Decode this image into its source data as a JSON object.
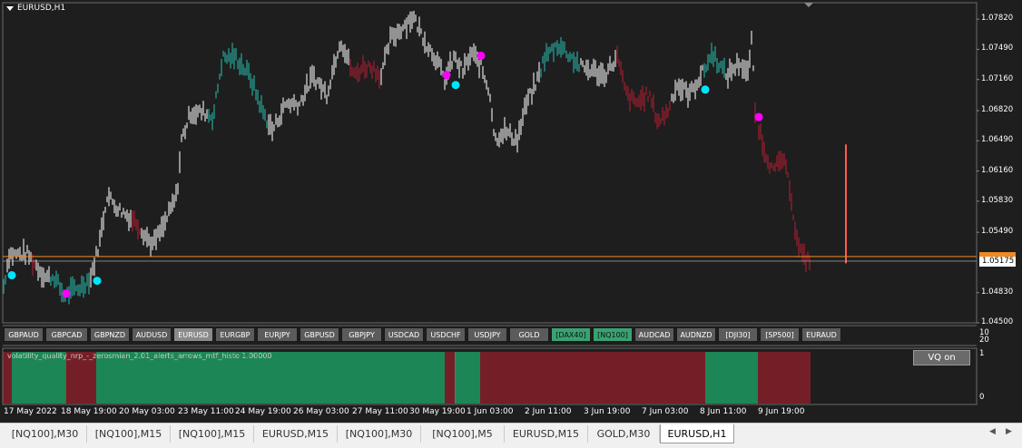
{
  "window": {
    "title": "EURUSD,H1"
  },
  "price_axis": [
    "1.07820",
    "1.07490",
    "1.07160",
    "1.06820",
    "1.06490",
    "1.06160",
    "1.05830",
    "1.05490",
    "1.04830",
    "1.04500"
  ],
  "current_price": "1.05175",
  "time_axis": [
    "17 May 2022",
    "18 May 19:00",
    "20 May 03:00",
    "23 May 11:00",
    "24 May 19:00",
    "26 May 03:00",
    "27 May 11:00",
    "30 May 19:00",
    "1 Jun 03:00",
    "2 Jun 11:00",
    "3 Jun 19:00",
    "7 Jun 03:00",
    "8 Jun 11:00",
    "9 Jun 19:00"
  ],
  "tickers": [
    {
      "label": "GBPAUD",
      "state": "normal"
    },
    {
      "label": "GBPCAD",
      "state": "normal"
    },
    {
      "label": "GBPNZD",
      "state": "normal"
    },
    {
      "label": "AUDUSD",
      "state": "normal"
    },
    {
      "label": "EURUSD",
      "state": "active"
    },
    {
      "label": "EURGBP",
      "state": "normal"
    },
    {
      "label": "EURJPY",
      "state": "normal"
    },
    {
      "label": "GBPUSD",
      "state": "normal"
    },
    {
      "label": "GBPJPY",
      "state": "normal"
    },
    {
      "label": "USDCAD",
      "state": "normal"
    },
    {
      "label": "USDCHF",
      "state": "normal"
    },
    {
      "label": "USDJPY",
      "state": "normal"
    },
    {
      "label": "GOLD",
      "state": "normal"
    },
    {
      "label": "[DAX40]",
      "state": "green"
    },
    {
      "label": "[NQ100]",
      "state": "green"
    },
    {
      "label": "AUDCAD",
      "state": "normal"
    },
    {
      "label": "AUDNZD",
      "state": "normal"
    },
    {
      "label": "[DJI30]",
      "state": "normal"
    },
    {
      "label": "[SP500]",
      "state": "normal"
    },
    {
      "label": "EURAUD",
      "state": "normal"
    }
  ],
  "indicator": {
    "label": "volatility_quality_nrp_-_zerosmian_2.01_alerts_arrows_mtf_histo 1.00000",
    "button": "VQ on",
    "scale_top": "20",
    "scale_1": "1",
    "scale_0": "0",
    "scale_sep": "10"
  },
  "tabs": [
    "[NQ100],M30",
    "[NQ100],M15",
    "[NQ100],M15",
    "EURUSD,M15",
    "[NQ100],M30",
    "[NQ100],M5",
    "EURUSD,M15",
    "GOLD,M30",
    "EURUSD,H1"
  ],
  "active_tab_index": 8,
  "colors": {
    "bull": "#26a69a",
    "bull_bright": "#2ecc8a",
    "bear": "#a01f2e",
    "neutral": "#e0e0e0",
    "signal_up": "#00e5ff",
    "signal_down": "#ff00ff",
    "price_line": "#f08a24",
    "histo_green": "#1dbf74",
    "histo_red": "#a3202d"
  },
  "chart_data": {
    "type": "bar",
    "title": "EURUSD,H1",
    "ylim": [
      1.045,
      1.0795
    ],
    "series_color_segments": [
      {
        "color": "bull",
        "from": 0,
        "to": 8
      },
      {
        "color": "neutral",
        "from": 8,
        "to": 36
      },
      {
        "color": "bear",
        "from": 36,
        "to": 40
      },
      {
        "color": "neutral",
        "from": 40,
        "to": 56
      },
      {
        "color": "bull",
        "from": 56,
        "to": 100
      },
      {
        "color": "neutral",
        "from": 100,
        "to": 145
      },
      {
        "color": "bear",
        "from": 145,
        "to": 155
      },
      {
        "color": "neutral",
        "from": 155,
        "to": 230
      },
      {
        "color": "bull",
        "from": 230,
        "to": 295
      },
      {
        "color": "neutral",
        "from": 295,
        "to": 385
      },
      {
        "color": "bear",
        "from": 385,
        "to": 420
      },
      {
        "color": "neutral",
        "from": 420,
        "to": 595
      },
      {
        "color": "bull",
        "from": 595,
        "to": 640
      },
      {
        "color": "neutral",
        "from": 640,
        "to": 680
      },
      {
        "color": "bear",
        "from": 680,
        "to": 740
      },
      {
        "color": "neutral",
        "from": 740,
        "to": 775
      },
      {
        "color": "bull",
        "from": 775,
        "to": 800
      },
      {
        "color": "neutral",
        "from": 800,
        "to": 832
      },
      {
        "color": "bear",
        "from": 832,
        "to": 895
      }
    ],
    "price_path": [
      [
        4,
        1.049
      ],
      [
        10,
        1.0525
      ],
      [
        30,
        1.0525
      ],
      [
        42,
        1.051
      ],
      [
        50,
        1.05
      ],
      [
        60,
        1.05
      ],
      [
        70,
        1.048
      ],
      [
        80,
        1.0485
      ],
      [
        90,
        1.049
      ],
      [
        100,
        1.05
      ],
      [
        110,
        1.054
      ],
      [
        118,
        1.059
      ],
      [
        130,
        1.0575
      ],
      [
        150,
        1.056
      ],
      [
        168,
        1.0535
      ],
      [
        180,
        1.0555
      ],
      [
        195,
        1.059
      ],
      [
        200,
        1.065
      ],
      [
        210,
        1.068
      ],
      [
        225,
        1.068
      ],
      [
        235,
        1.0675
      ],
      [
        245,
        1.074
      ],
      [
        260,
        1.074
      ],
      [
        275,
        1.072
      ],
      [
        290,
        1.068
      ],
      [
        300,
        1.066
      ],
      [
        315,
        1.069
      ],
      [
        330,
        1.069
      ],
      [
        345,
        1.072
      ],
      [
        360,
        1.07
      ],
      [
        375,
        1.076
      ],
      [
        390,
        1.072
      ],
      [
        400,
        1.073
      ],
      [
        410,
        1.073
      ],
      [
        420,
        1.072
      ],
      [
        430,
        1.076
      ],
      [
        440,
        1.077
      ],
      [
        455,
        1.0785
      ],
      [
        465,
        1.0765
      ],
      [
        470,
        1.0755
      ],
      [
        480,
        1.074
      ],
      [
        490,
        1.0715
      ],
      [
        500,
        1.074
      ],
      [
        510,
        1.0725
      ],
      [
        520,
        1.0745
      ],
      [
        530,
        1.073
      ],
      [
        540,
        1.07
      ],
      [
        545,
        1.065
      ],
      [
        555,
        1.066
      ],
      [
        570,
        1.065
      ],
      [
        580,
        1.069
      ],
      [
        590,
        1.071
      ],
      [
        600,
        1.074
      ],
      [
        615,
        1.0755
      ],
      [
        625,
        1.0745
      ],
      [
        640,
        1.073
      ],
      [
        655,
        1.0725
      ],
      [
        665,
        1.072
      ],
      [
        680,
        1.074
      ],
      [
        690,
        1.07
      ],
      [
        700,
        1.069
      ],
      [
        715,
        1.07
      ],
      [
        725,
        1.067
      ],
      [
        735,
        1.068
      ],
      [
        745,
        1.071
      ],
      [
        760,
        1.07
      ],
      [
        775,
        1.0725
      ],
      [
        785,
        1.0745
      ],
      [
        800,
        1.072
      ],
      [
        815,
        1.0735
      ],
      [
        825,
        1.072
      ],
      [
        828,
        1.0765
      ],
      [
        832,
        1.068
      ],
      [
        842,
        1.064
      ],
      [
        852,
        1.0615
      ],
      [
        862,
        1.063
      ],
      [
        870,
        1.06
      ],
      [
        878,
        1.054
      ],
      [
        885,
        1.052
      ],
      [
        892,
        1.052
      ]
    ],
    "signals": [
      {
        "type": "up",
        "x": 13,
        "price": 1.0502
      },
      {
        "type": "down",
        "x": 73,
        "price": 1.0482
      },
      {
        "type": "up",
        "x": 107,
        "price": 1.0496
      },
      {
        "type": "down",
        "x": 492,
        "price": 1.0721
      },
      {
        "type": "up",
        "x": 502,
        "price": 1.071
      },
      {
        "type": "down",
        "x": 530,
        "price": 1.0742
      },
      {
        "type": "up",
        "x": 777,
        "price": 1.0705
      },
      {
        "type": "down",
        "x": 836,
        "price": 1.0675
      }
    ],
    "spike": {
      "x": 932,
      "from": 1.0515,
      "to": 1.0645
    },
    "histogram_segments": [
      {
        "color": "histo_red",
        "from": 4,
        "to": 14
      },
      {
        "color": "histo_green",
        "from": 14,
        "to": 73
      },
      {
        "color": "histo_red",
        "from": 73,
        "to": 107
      },
      {
        "color": "histo_green",
        "from": 107,
        "to": 491
      },
      {
        "color": "histo_red",
        "from": 491,
        "to": 502
      },
      {
        "color": "histo_green",
        "from": 502,
        "to": 530
      },
      {
        "color": "histo_red",
        "from": 530,
        "to": 778
      },
      {
        "color": "histo_green",
        "from": 778,
        "to": 836
      },
      {
        "color": "histo_red",
        "from": 836,
        "to": 894
      }
    ]
  }
}
